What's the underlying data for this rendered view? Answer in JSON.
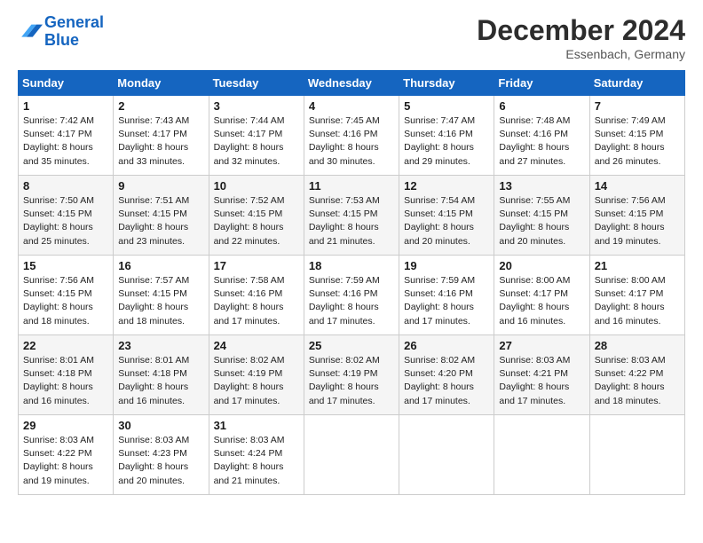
{
  "header": {
    "logo_line1": "General",
    "logo_line2": "Blue",
    "month": "December 2024",
    "location": "Essenbach, Germany"
  },
  "weekdays": [
    "Sunday",
    "Monday",
    "Tuesday",
    "Wednesday",
    "Thursday",
    "Friday",
    "Saturday"
  ],
  "weeks": [
    [
      {
        "day": "1",
        "sunrise": "Sunrise: 7:42 AM",
        "sunset": "Sunset: 4:17 PM",
        "daylight": "Daylight: 8 hours and 35 minutes."
      },
      {
        "day": "2",
        "sunrise": "Sunrise: 7:43 AM",
        "sunset": "Sunset: 4:17 PM",
        "daylight": "Daylight: 8 hours and 33 minutes."
      },
      {
        "day": "3",
        "sunrise": "Sunrise: 7:44 AM",
        "sunset": "Sunset: 4:17 PM",
        "daylight": "Daylight: 8 hours and 32 minutes."
      },
      {
        "day": "4",
        "sunrise": "Sunrise: 7:45 AM",
        "sunset": "Sunset: 4:16 PM",
        "daylight": "Daylight: 8 hours and 30 minutes."
      },
      {
        "day": "5",
        "sunrise": "Sunrise: 7:47 AM",
        "sunset": "Sunset: 4:16 PM",
        "daylight": "Daylight: 8 hours and 29 minutes."
      },
      {
        "day": "6",
        "sunrise": "Sunrise: 7:48 AM",
        "sunset": "Sunset: 4:16 PM",
        "daylight": "Daylight: 8 hours and 27 minutes."
      },
      {
        "day": "7",
        "sunrise": "Sunrise: 7:49 AM",
        "sunset": "Sunset: 4:15 PM",
        "daylight": "Daylight: 8 hours and 26 minutes."
      }
    ],
    [
      {
        "day": "8",
        "sunrise": "Sunrise: 7:50 AM",
        "sunset": "Sunset: 4:15 PM",
        "daylight": "Daylight: 8 hours and 25 minutes."
      },
      {
        "day": "9",
        "sunrise": "Sunrise: 7:51 AM",
        "sunset": "Sunset: 4:15 PM",
        "daylight": "Daylight: 8 hours and 23 minutes."
      },
      {
        "day": "10",
        "sunrise": "Sunrise: 7:52 AM",
        "sunset": "Sunset: 4:15 PM",
        "daylight": "Daylight: 8 hours and 22 minutes."
      },
      {
        "day": "11",
        "sunrise": "Sunrise: 7:53 AM",
        "sunset": "Sunset: 4:15 PM",
        "daylight": "Daylight: 8 hours and 21 minutes."
      },
      {
        "day": "12",
        "sunrise": "Sunrise: 7:54 AM",
        "sunset": "Sunset: 4:15 PM",
        "daylight": "Daylight: 8 hours and 20 minutes."
      },
      {
        "day": "13",
        "sunrise": "Sunrise: 7:55 AM",
        "sunset": "Sunset: 4:15 PM",
        "daylight": "Daylight: 8 hours and 20 minutes."
      },
      {
        "day": "14",
        "sunrise": "Sunrise: 7:56 AM",
        "sunset": "Sunset: 4:15 PM",
        "daylight": "Daylight: 8 hours and 19 minutes."
      }
    ],
    [
      {
        "day": "15",
        "sunrise": "Sunrise: 7:56 AM",
        "sunset": "Sunset: 4:15 PM",
        "daylight": "Daylight: 8 hours and 18 minutes."
      },
      {
        "day": "16",
        "sunrise": "Sunrise: 7:57 AM",
        "sunset": "Sunset: 4:15 PM",
        "daylight": "Daylight: 8 hours and 18 minutes."
      },
      {
        "day": "17",
        "sunrise": "Sunrise: 7:58 AM",
        "sunset": "Sunset: 4:16 PM",
        "daylight": "Daylight: 8 hours and 17 minutes."
      },
      {
        "day": "18",
        "sunrise": "Sunrise: 7:59 AM",
        "sunset": "Sunset: 4:16 PM",
        "daylight": "Daylight: 8 hours and 17 minutes."
      },
      {
        "day": "19",
        "sunrise": "Sunrise: 7:59 AM",
        "sunset": "Sunset: 4:16 PM",
        "daylight": "Daylight: 8 hours and 17 minutes."
      },
      {
        "day": "20",
        "sunrise": "Sunrise: 8:00 AM",
        "sunset": "Sunset: 4:17 PM",
        "daylight": "Daylight: 8 hours and 16 minutes."
      },
      {
        "day": "21",
        "sunrise": "Sunrise: 8:00 AM",
        "sunset": "Sunset: 4:17 PM",
        "daylight": "Daylight: 8 hours and 16 minutes."
      }
    ],
    [
      {
        "day": "22",
        "sunrise": "Sunrise: 8:01 AM",
        "sunset": "Sunset: 4:18 PM",
        "daylight": "Daylight: 8 hours and 16 minutes."
      },
      {
        "day": "23",
        "sunrise": "Sunrise: 8:01 AM",
        "sunset": "Sunset: 4:18 PM",
        "daylight": "Daylight: 8 hours and 16 minutes."
      },
      {
        "day": "24",
        "sunrise": "Sunrise: 8:02 AM",
        "sunset": "Sunset: 4:19 PM",
        "daylight": "Daylight: 8 hours and 17 minutes."
      },
      {
        "day": "25",
        "sunrise": "Sunrise: 8:02 AM",
        "sunset": "Sunset: 4:19 PM",
        "daylight": "Daylight: 8 hours and 17 minutes."
      },
      {
        "day": "26",
        "sunrise": "Sunrise: 8:02 AM",
        "sunset": "Sunset: 4:20 PM",
        "daylight": "Daylight: 8 hours and 17 minutes."
      },
      {
        "day": "27",
        "sunrise": "Sunrise: 8:03 AM",
        "sunset": "Sunset: 4:21 PM",
        "daylight": "Daylight: 8 hours and 17 minutes."
      },
      {
        "day": "28",
        "sunrise": "Sunrise: 8:03 AM",
        "sunset": "Sunset: 4:22 PM",
        "daylight": "Daylight: 8 hours and 18 minutes."
      }
    ],
    [
      {
        "day": "29",
        "sunrise": "Sunrise: 8:03 AM",
        "sunset": "Sunset: 4:22 PM",
        "daylight": "Daylight: 8 hours and 19 minutes."
      },
      {
        "day": "30",
        "sunrise": "Sunrise: 8:03 AM",
        "sunset": "Sunset: 4:23 PM",
        "daylight": "Daylight: 8 hours and 20 minutes."
      },
      {
        "day": "31",
        "sunrise": "Sunrise: 8:03 AM",
        "sunset": "Sunset: 4:24 PM",
        "daylight": "Daylight: 8 hours and 21 minutes."
      },
      null,
      null,
      null,
      null
    ]
  ]
}
